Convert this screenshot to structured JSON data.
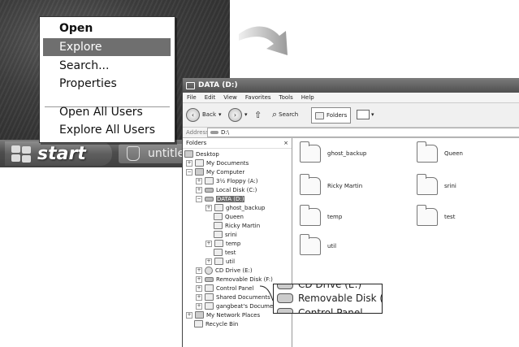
{
  "context_menu": {
    "items": [
      "Open",
      "Explore",
      "Search...",
      "Properties",
      "Open All Users",
      "Explore All Users"
    ]
  },
  "taskbar": {
    "start_label": "start",
    "task_label": "untitle"
  },
  "window": {
    "title": "DATA (D:)",
    "menu": [
      "File",
      "Edit",
      "View",
      "Favorites",
      "Tools",
      "Help"
    ],
    "toolbar": {
      "back": "Back",
      "search": "Search",
      "folders": "Folders"
    },
    "address_label": "Address",
    "address_value": "D:\\",
    "folders_pane_title": "Folders",
    "close_glyph": "×",
    "tree": [
      "Desktop",
      "My Documents",
      "My Computer",
      "3½ Floppy (A:)",
      "Local Disk (C:)",
      "DATA (D:)",
      "ghost_backup",
      "Queen",
      "Ricky Martin",
      "srini",
      "temp",
      "test",
      "util",
      "CD Drive (E:)",
      "Removable Disk (F:)",
      "Control Panel",
      "Shared Documents",
      "gangbeat's Documents",
      "My Network Places",
      "Recycle Bin"
    ],
    "content": [
      "ghost_backup",
      "Queen",
      "Ricky Martin",
      "srini",
      "temp",
      "test",
      "util"
    ]
  },
  "callout": {
    "rows": [
      "CD Drive (E:)",
      "Removable Disk (F:)",
      "Control Panel"
    ]
  },
  "colors": {
    "selection": "#6f6f6f",
    "titlebar": "#5a5a5a"
  }
}
